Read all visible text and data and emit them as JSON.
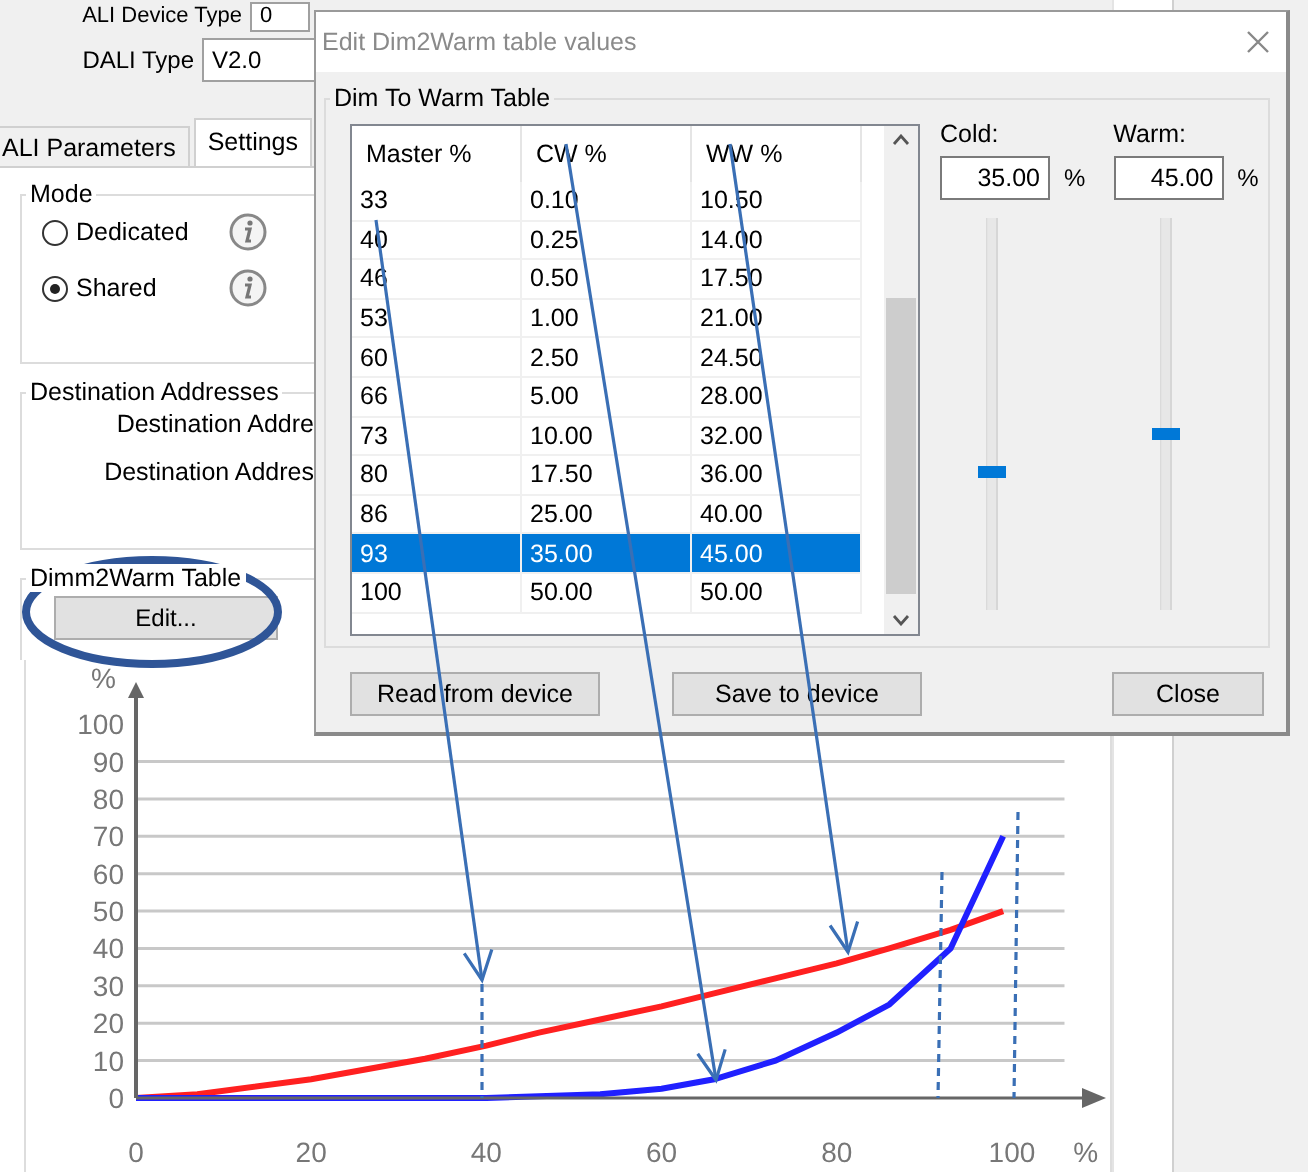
{
  "background": {
    "device_type": {
      "label": "ALI Device Type",
      "value": "0"
    },
    "dali_type": {
      "label": "DALI Type",
      "value": "V2.0"
    },
    "tabs": [
      {
        "label": "ALI Parameters",
        "selected": false
      },
      {
        "label": "Settings",
        "selected": true
      }
    ],
    "mode": {
      "title": "Mode",
      "options": [
        {
          "label": "Dedicated",
          "selected": false
        },
        {
          "label": "Shared",
          "selected": true
        }
      ]
    },
    "destination": {
      "title": "Destination Addresses",
      "labels": [
        "Destination Addre",
        "Destination Addres"
      ]
    },
    "table_group": {
      "title": "Dimm2Warm Table",
      "button": "Edit..."
    }
  },
  "dialog": {
    "title": "Edit Dim2Warm table values",
    "group_title": "Dim To Warm Table",
    "columns": [
      "Master %",
      "CW %",
      "WW %"
    ],
    "rows": [
      {
        "cells": [
          "33",
          "0.10",
          "10.50"
        ],
        "selected": false
      },
      {
        "cells": [
          "40",
          "0.25",
          "14.00"
        ],
        "selected": false
      },
      {
        "cells": [
          "46",
          "0.50",
          "17.50"
        ],
        "selected": false
      },
      {
        "cells": [
          "53",
          "1.00",
          "21.00"
        ],
        "selected": false
      },
      {
        "cells": [
          "60",
          "2.50",
          "24.50"
        ],
        "selected": false
      },
      {
        "cells": [
          "66",
          "5.00",
          "28.00"
        ],
        "selected": false
      },
      {
        "cells": [
          "73",
          "10.00",
          "32.00"
        ],
        "selected": false
      },
      {
        "cells": [
          "80",
          "17.50",
          "36.00"
        ],
        "selected": false
      },
      {
        "cells": [
          "86",
          "25.00",
          "40.00"
        ],
        "selected": false
      },
      {
        "cells": [
          "93",
          "35.00",
          "45.00"
        ],
        "selected": true
      },
      {
        "cells": [
          "100",
          "50.00",
          "50.00"
        ],
        "selected": false
      }
    ],
    "sliders": [
      {
        "label": "Cold:",
        "value": "35.00",
        "unit": "%",
        "level": 0.35
      },
      {
        "label": "Warm:",
        "value": "45.00",
        "unit": "%",
        "level": 0.45
      }
    ],
    "buttons": [
      "Read from device",
      "Save to device",
      "Close"
    ]
  },
  "chart": {
    "chart_data": {
      "type": "line",
      "xlabel": "%",
      "ylabel": "%",
      "x": [
        0,
        7,
        20,
        33,
        40,
        46,
        53,
        60,
        66,
        73,
        80,
        86,
        93,
        99
      ],
      "series": [
        {
          "color": "#ff2020",
          "values": [
            0,
            1,
            5,
            10.5,
            14,
            17.5,
            21,
            24.5,
            28,
            32,
            36,
            40,
            45,
            50
          ]
        },
        {
          "color": "#2020ff",
          "values": [
            0,
            0,
            0,
            0,
            0,
            0.5,
            1,
            2.5,
            5,
            10,
            17.5,
            25,
            40,
            70
          ]
        }
      ],
      "xlim": [
        0,
        108
      ],
      "ylim": [
        0,
        107
      ],
      "grid": true,
      "xticks": [
        0,
        20,
        40,
        60,
        80,
        100
      ],
      "yticks": [
        0,
        10,
        20,
        30,
        40,
        50,
        60,
        70,
        80,
        90,
        100
      ]
    }
  }
}
